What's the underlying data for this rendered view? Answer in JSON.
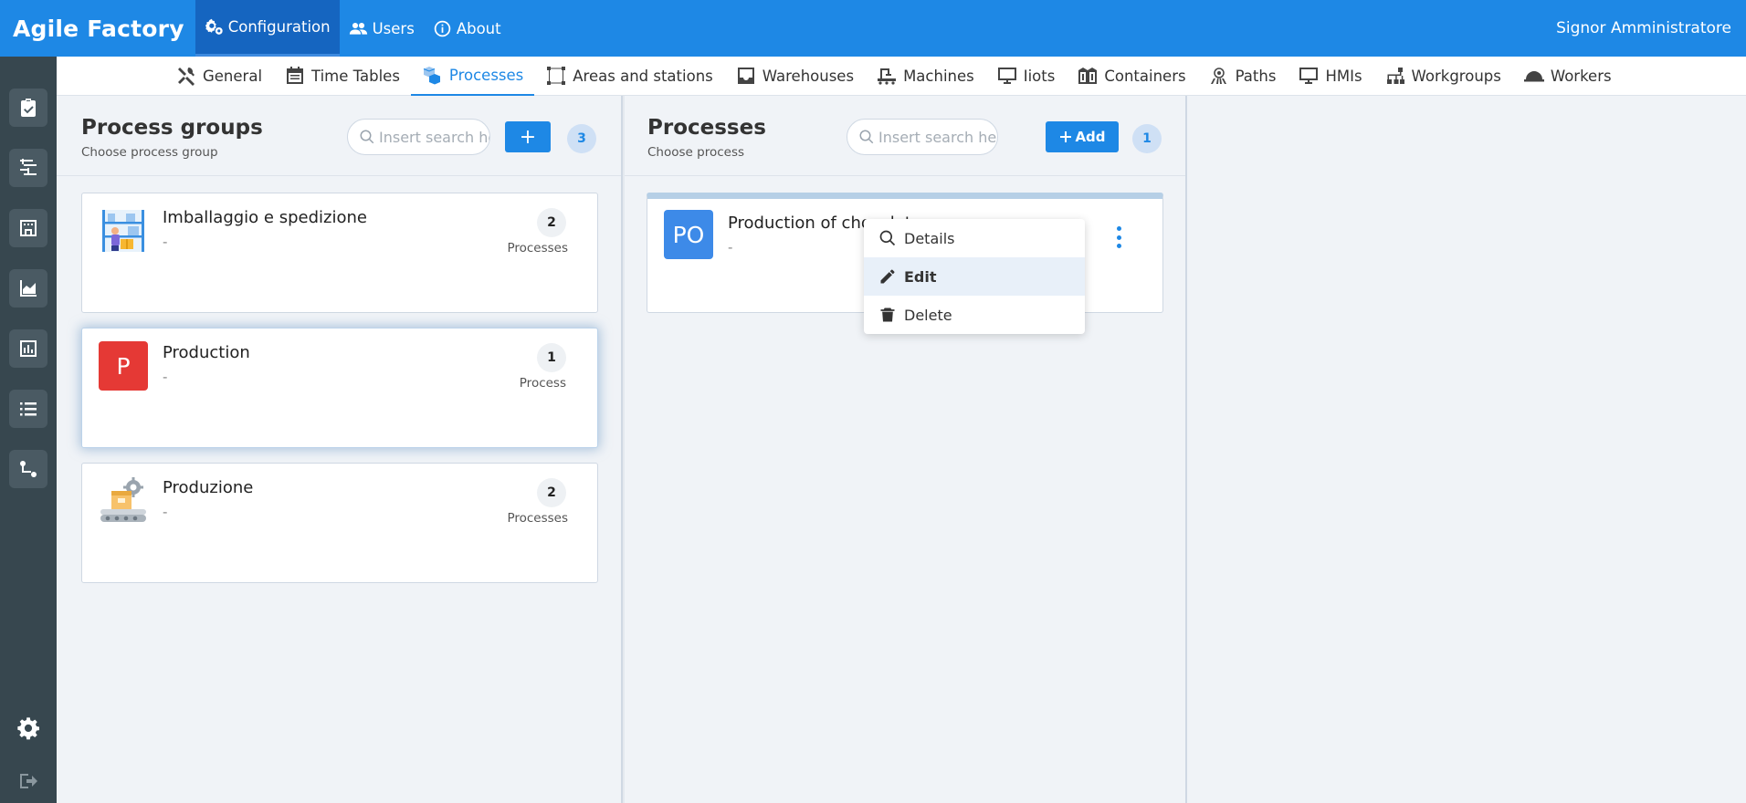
{
  "app": {
    "title": "Agile Factory",
    "user": "Signor Amministratore"
  },
  "topnav": [
    {
      "label": "Configuration",
      "icon": "gears-icon",
      "active": true
    },
    {
      "label": "Users",
      "icon": "users-icon",
      "active": false
    },
    {
      "label": "About",
      "icon": "info-icon",
      "active": false
    }
  ],
  "subnav": [
    {
      "label": "General",
      "icon": "tools-icon"
    },
    {
      "label": "Time Tables",
      "icon": "calendar-icon"
    },
    {
      "label": "Processes",
      "icon": "cubes-icon",
      "active": true
    },
    {
      "label": "Areas and stations",
      "icon": "area-icon"
    },
    {
      "label": "Warehouses",
      "icon": "inbox-icon"
    },
    {
      "label": "Machines",
      "icon": "machine-icon"
    },
    {
      "label": "Iiots",
      "icon": "monitor-icon"
    },
    {
      "label": "Containers",
      "icon": "containers-icon"
    },
    {
      "label": "Paths",
      "icon": "paths-icon"
    },
    {
      "label": "HMIs",
      "icon": "monitor-icon"
    },
    {
      "label": "Workgroups",
      "icon": "workgroups-icon"
    },
    {
      "label": "Workers",
      "icon": "helmet-icon"
    }
  ],
  "process_groups": {
    "title": "Process groups",
    "subtitle": "Choose process group",
    "search_placeholder": "Insert search here...",
    "add_label": "+",
    "count": "3",
    "items": [
      {
        "title": "Imballaggio e spedizione",
        "desc": "-",
        "count": "2",
        "count_label": "Processes",
        "avatar": "warehouse-worker-image"
      },
      {
        "title": "Production",
        "desc": "-",
        "count": "1",
        "count_label": "Process",
        "avatar_text": "P",
        "avatar_color": "#e53935",
        "selected": true
      },
      {
        "title": "Produzione",
        "desc": "-",
        "count": "2",
        "count_label": "Processes",
        "avatar": "conveyor-image"
      }
    ]
  },
  "processes": {
    "title": "Processes",
    "subtitle": "Choose process",
    "search_placeholder": "Insert search here...",
    "add_label": "Add",
    "count": "1",
    "items": [
      {
        "title": "Production of chocolate",
        "desc": "-",
        "avatar_text": "PO",
        "avatar_color": "#1e88e5"
      }
    ]
  },
  "context_menu": {
    "items": [
      {
        "label": "Details",
        "icon": "search-icon"
      },
      {
        "label": "Edit",
        "icon": "pencil-icon",
        "hover": true
      },
      {
        "label": "Delete",
        "icon": "trash-icon"
      }
    ]
  }
}
